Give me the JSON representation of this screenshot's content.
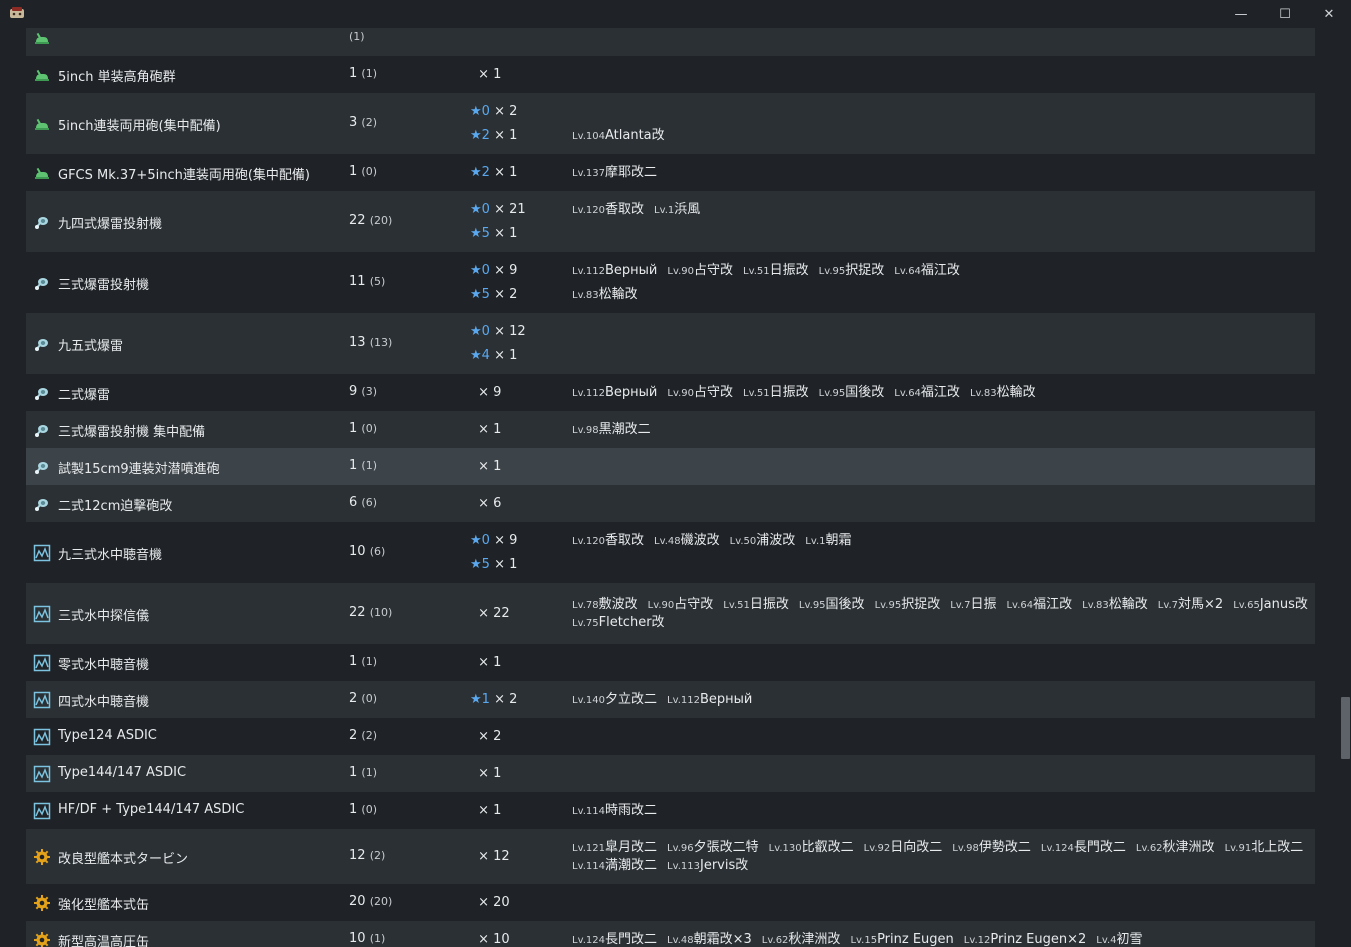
{
  "window": {
    "minimize_glyph": "—",
    "maximize_glyph": "☐",
    "close_glyph": "✕"
  },
  "colors": {
    "background": "#1f2327",
    "row_alt": "#2a3034",
    "row_highlight": "#3d4449",
    "star": "#5aa9f0"
  },
  "rows": [
    {
      "icon": "aa-gun-icon",
      "name": "",
      "count": "",
      "sub": "(1)",
      "stars": [],
      "ships": []
    },
    {
      "icon": "aa-gun-icon",
      "name": "5inch 単装高角砲群",
      "count": "1",
      "sub": "(1)",
      "stars": [
        {
          "star": "",
          "text": "× 1"
        }
      ],
      "ships": []
    },
    {
      "icon": "aa-gun-icon",
      "name": "5inch連装両用砲(集中配備)",
      "count": "3",
      "sub": "(2)",
      "stars": [
        {
          "star": "★0",
          "text": "× 2"
        },
        {
          "star": "★2",
          "text": "× 1"
        }
      ],
      "ships": [
        [],
        [
          {
            "lv": "Lv.104",
            "name": "Atlanta改"
          }
        ]
      ]
    },
    {
      "icon": "aa-gun-icon",
      "name": "GFCS Mk.37+5inch連装両用砲(集中配備)",
      "count": "1",
      "sub": "(0)",
      "stars": [
        {
          "star": "★2",
          "text": "× 1"
        }
      ],
      "ships": [
        [
          {
            "lv": "Lv.137",
            "name": "摩耶改二"
          }
        ]
      ]
    },
    {
      "icon": "depth-charge-icon",
      "name": "九四式爆雷投射機",
      "count": "22",
      "sub": "(20)",
      "stars": [
        {
          "star": "★0",
          "text": "× 21"
        },
        {
          "star": "★5",
          "text": "× 1"
        }
      ],
      "ships": [
        [
          {
            "lv": "Lv.120",
            "name": "香取改"
          },
          {
            "lv": "Lv.1",
            "name": "浜風"
          }
        ]
      ]
    },
    {
      "icon": "depth-charge-icon",
      "name": "三式爆雷投射機",
      "count": "11",
      "sub": "(5)",
      "stars": [
        {
          "star": "★0",
          "text": "× 9"
        },
        {
          "star": "★5",
          "text": "× 2"
        }
      ],
      "ships": [
        [
          {
            "lv": "Lv.112",
            "name": "Верный"
          },
          {
            "lv": "Lv.90",
            "name": "占守改"
          },
          {
            "lv": "Lv.51",
            "name": "日振改"
          },
          {
            "lv": "Lv.95",
            "name": "択捉改"
          },
          {
            "lv": "Lv.64",
            "name": "福江改"
          }
        ],
        [
          {
            "lv": "Lv.83",
            "name": "松輪改"
          }
        ]
      ]
    },
    {
      "icon": "depth-charge-icon",
      "name": "九五式爆雷",
      "count": "13",
      "sub": "(13)",
      "stars": [
        {
          "star": "★0",
          "text": "× 12"
        },
        {
          "star": "★4",
          "text": "× 1"
        }
      ],
      "ships": []
    },
    {
      "icon": "depth-charge-icon",
      "name": "二式爆雷",
      "count": "9",
      "sub": "(3)",
      "stars": [
        {
          "star": "",
          "text": "× 9"
        }
      ],
      "ships": [
        [
          {
            "lv": "Lv.112",
            "name": "Верный"
          },
          {
            "lv": "Lv.90",
            "name": "占守改"
          },
          {
            "lv": "Lv.51",
            "name": "日振改"
          },
          {
            "lv": "Lv.95",
            "name": "国後改"
          },
          {
            "lv": "Lv.64",
            "name": "福江改"
          },
          {
            "lv": "Lv.83",
            "name": "松輪改"
          }
        ]
      ]
    },
    {
      "icon": "depth-charge-icon",
      "name": "三式爆雷投射機 集中配備",
      "count": "1",
      "sub": "(0)",
      "stars": [
        {
          "star": "",
          "text": "× 1"
        }
      ],
      "ships": [
        [
          {
            "lv": "Lv.98",
            "name": "黒潮改二"
          }
        ]
      ]
    },
    {
      "icon": "depth-charge-icon",
      "name": "試製15cm9連装対潜噴進砲",
      "count": "1",
      "sub": "(1)",
      "stars": [
        {
          "star": "",
          "text": "× 1"
        }
      ],
      "ships": []
    },
    {
      "icon": "depth-charge-icon",
      "name": "二式12cm迫撃砲改",
      "count": "6",
      "sub": "(6)",
      "stars": [
        {
          "star": "",
          "text": "× 6"
        }
      ],
      "ships": []
    },
    {
      "icon": "sonar-icon",
      "name": "九三式水中聴音機",
      "count": "10",
      "sub": "(6)",
      "stars": [
        {
          "star": "★0",
          "text": "× 9"
        },
        {
          "star": "★5",
          "text": "× 1"
        }
      ],
      "ships": [
        [
          {
            "lv": "Lv.120",
            "name": "香取改"
          },
          {
            "lv": "Lv.48",
            "name": "磯波改"
          },
          {
            "lv": "Lv.50",
            "name": "浦波改"
          },
          {
            "lv": "Lv.1",
            "name": "朝霜"
          }
        ]
      ]
    },
    {
      "icon": "sonar-icon",
      "name": "三式水中探信儀",
      "count": "22",
      "sub": "(10)",
      "stars": [
        {
          "star": "",
          "text": "× 22"
        }
      ],
      "ships": [
        [
          {
            "lv": "Lv.78",
            "name": "敷波改"
          },
          {
            "lv": "Lv.90",
            "name": "占守改"
          },
          {
            "lv": "Lv.51",
            "name": "日振改"
          },
          {
            "lv": "Lv.95",
            "name": "国後改"
          },
          {
            "lv": "Lv.95",
            "name": "択捉改"
          },
          {
            "lv": "Lv.7",
            "name": "日振"
          },
          {
            "lv": "Lv.64",
            "name": "福江改"
          },
          {
            "lv": "Lv.83",
            "name": "松輪改"
          },
          {
            "lv": "Lv.7",
            "name": "対馬×2"
          },
          {
            "lv": "Lv.65",
            "name": "Janus改"
          }
        ],
        [
          {
            "lv": "Lv.75",
            "name": "Fletcher改"
          }
        ]
      ]
    },
    {
      "icon": "sonar-icon",
      "name": "零式水中聴音機",
      "count": "1",
      "sub": "(1)",
      "stars": [
        {
          "star": "",
          "text": "× 1"
        }
      ],
      "ships": []
    },
    {
      "icon": "sonar-icon",
      "name": "四式水中聴音機",
      "count": "2",
      "sub": "(0)",
      "stars": [
        {
          "star": "★1",
          "text": "× 2"
        }
      ],
      "ships": [
        [
          {
            "lv": "Lv.140",
            "name": "夕立改二"
          },
          {
            "lv": "Lv.112",
            "name": "Верный"
          }
        ]
      ]
    },
    {
      "icon": "sonar-icon",
      "name": "Type124 ASDIC",
      "count": "2",
      "sub": "(2)",
      "stars": [
        {
          "star": "",
          "text": "× 2"
        }
      ],
      "ships": []
    },
    {
      "icon": "sonar-icon",
      "name": "Type144/147 ASDIC",
      "count": "1",
      "sub": "(1)",
      "stars": [
        {
          "star": "",
          "text": "× 1"
        }
      ],
      "ships": []
    },
    {
      "icon": "sonar-icon",
      "name": "HF/DF + Type144/147 ASDIC",
      "count": "1",
      "sub": "(0)",
      "stars": [
        {
          "star": "",
          "text": "× 1"
        }
      ],
      "ships": [
        [
          {
            "lv": "Lv.114",
            "name": "時雨改二"
          }
        ]
      ]
    },
    {
      "icon": "engine-gear-icon",
      "name": "改良型艦本式タービン",
      "count": "12",
      "sub": "(2)",
      "stars": [
        {
          "star": "",
          "text": "× 12"
        }
      ],
      "ships": [
        [
          {
            "lv": "Lv.121",
            "name": "皐月改二"
          },
          {
            "lv": "Lv.96",
            "name": "夕張改二特"
          },
          {
            "lv": "Lv.130",
            "name": "比叡改二"
          },
          {
            "lv": "Lv.92",
            "name": "日向改二"
          },
          {
            "lv": "Lv.98",
            "name": "伊勢改二"
          },
          {
            "lv": "Lv.124",
            "name": "長門改二"
          },
          {
            "lv": "Lv.62",
            "name": "秋津洲改"
          },
          {
            "lv": "Lv.91",
            "name": "北上改二"
          }
        ],
        [
          {
            "lv": "Lv.114",
            "name": "満潮改二"
          },
          {
            "lv": "Lv.113",
            "name": "Jervis改"
          }
        ]
      ]
    },
    {
      "icon": "engine-gear-icon",
      "name": "強化型艦本式缶",
      "count": "20",
      "sub": "(20)",
      "stars": [
        {
          "star": "",
          "text": "× 20"
        }
      ],
      "ships": []
    },
    {
      "icon": "engine-gear-icon",
      "name": "新型高温高圧缶",
      "count": "10",
      "sub": "(1)",
      "stars": [
        {
          "star": "",
          "text": "× 10"
        }
      ],
      "ships": [
        [
          {
            "lv": "Lv.124",
            "name": "長門改二"
          },
          {
            "lv": "Lv.48",
            "name": "朝霜改×3"
          },
          {
            "lv": "Lv.62",
            "name": "秋津洲改"
          },
          {
            "lv": "Lv.15",
            "name": "Prinz Eugen"
          },
          {
            "lv": "Lv.12",
            "name": "Prinz Eugen×2"
          },
          {
            "lv": "Lv.4",
            "name": "初雪"
          }
        ]
      ]
    }
  ]
}
